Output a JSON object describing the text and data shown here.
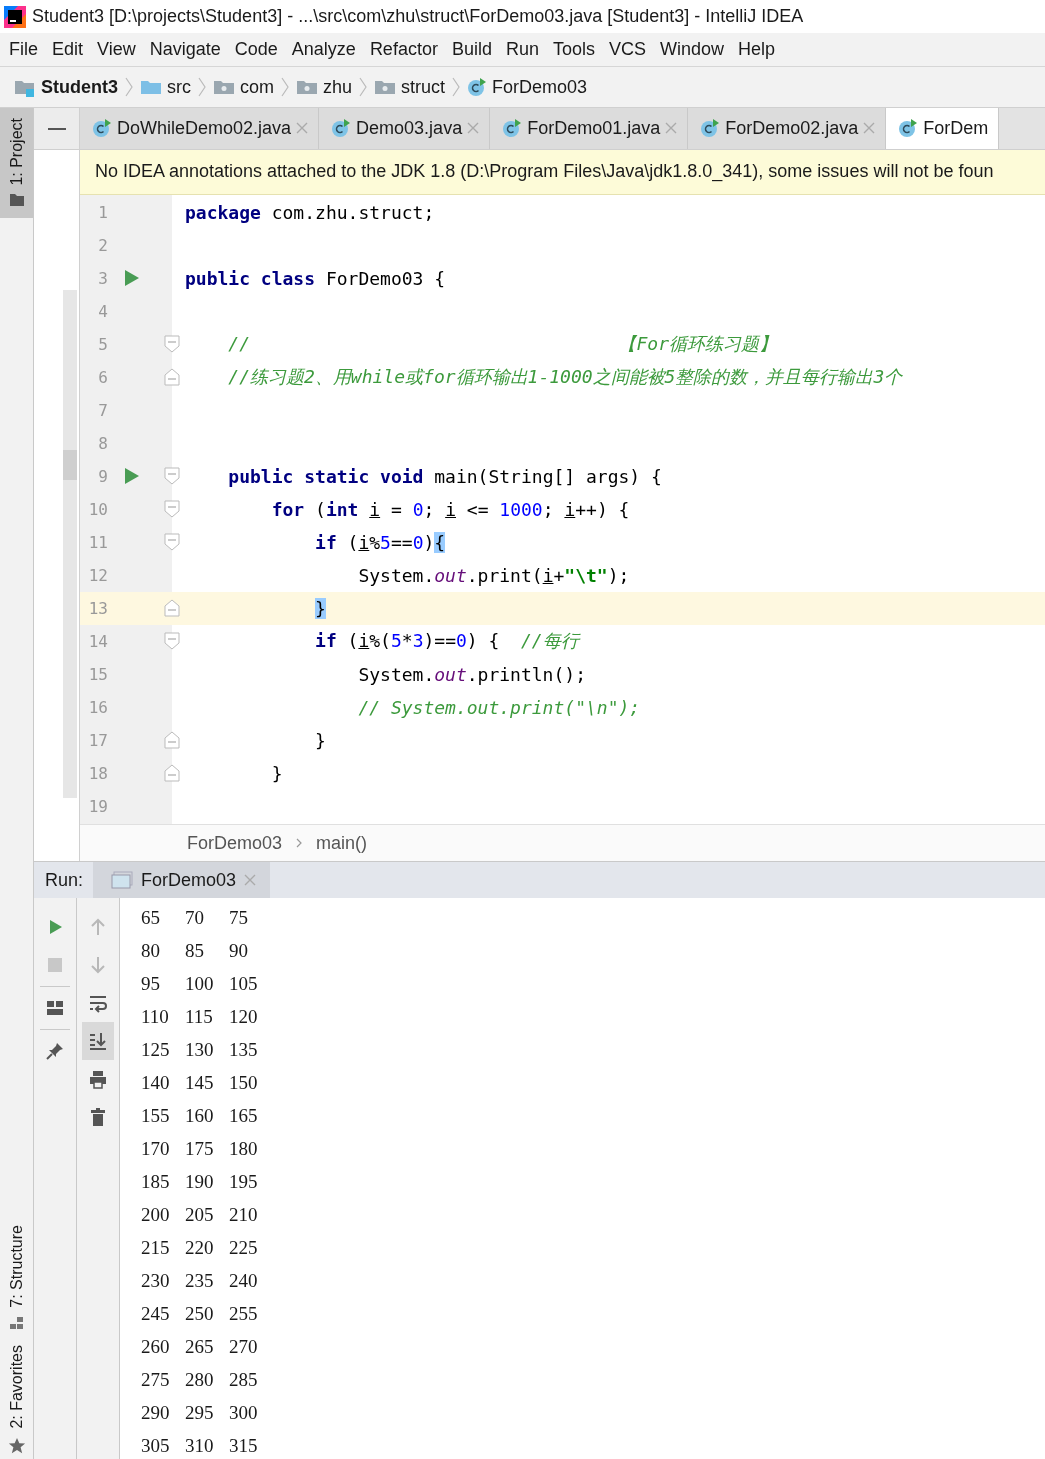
{
  "window": {
    "title": "Student3 [D:\\projects\\Student3] - ...\\src\\com\\zhu\\struct\\ForDemo03.java [Student3] - IntelliJ IDEA"
  },
  "menu": [
    "File",
    "Edit",
    "View",
    "Navigate",
    "Code",
    "Analyze",
    "Refactor",
    "Build",
    "Run",
    "Tools",
    "VCS",
    "Window",
    "Help"
  ],
  "nav_bar": [
    {
      "label": "Student3",
      "kind": "project"
    },
    {
      "label": "src",
      "kind": "source"
    },
    {
      "label": "com",
      "kind": "package"
    },
    {
      "label": "zhu",
      "kind": "package"
    },
    {
      "label": "struct",
      "kind": "package"
    },
    {
      "label": "ForDemo03",
      "kind": "class"
    }
  ],
  "tool_windows": {
    "top": [
      {
        "label": "1: Project",
        "kind": "project",
        "selected": true
      }
    ],
    "bottom": [
      {
        "label": "7: Structure",
        "kind": "structure",
        "selected": false
      },
      {
        "label": "2: Favorites",
        "kind": "favorites",
        "selected": false
      }
    ]
  },
  "tabs": [
    {
      "label": "DoWhileDemo02.java",
      "selected": false
    },
    {
      "label": "Demo03.java",
      "selected": false
    },
    {
      "label": "ForDemo01.java",
      "selected": false
    },
    {
      "label": "ForDemo02.java",
      "selected": false
    },
    {
      "label": "ForDem",
      "selected": true
    }
  ],
  "banner": "No IDEA annotations attached to the JDK 1.8 (D:\\Program Files\\Java\\jdk1.8.0_341), some issues will not be foun",
  "code": {
    "lines": [
      {
        "number": "1",
        "kind": "plain",
        "current": false,
        "run_marker": false,
        "tokens": [
          {
            "kind": "keyword",
            "text": "package"
          },
          {
            "kind": "plain",
            "text": " com.zhu.struct;"
          }
        ]
      },
      {
        "number": "2",
        "kind": "plain",
        "current": false,
        "run_marker": false
      },
      {
        "number": "3",
        "kind": "plain",
        "current": false,
        "run_marker": true,
        "tokens": [
          {
            "kind": "keyword",
            "text": "public class"
          },
          {
            "kind": "plain",
            "text": " ForDemo03 {"
          }
        ]
      },
      {
        "number": "4",
        "kind": "plain",
        "current": false,
        "run_marker": false
      },
      {
        "number": "5",
        "kind": "fold_start",
        "current": false,
        "run_marker": false,
        "tokens": [
          {
            "kind": "comment",
            "text": "    //                                  【For循环练习题】"
          }
        ]
      },
      {
        "number": "6",
        "kind": "fold_end",
        "current": false,
        "run_marker": false,
        "tokens": [
          {
            "kind": "comment",
            "text": "    //练习题2、用while或for循环输出1-1000之间能被5整除的数，并且每行输出3个"
          }
        ]
      },
      {
        "number": "7",
        "kind": "plain",
        "current": false,
        "run_marker": false
      },
      {
        "number": "8",
        "kind": "plain",
        "current": false,
        "run_marker": false
      },
      {
        "number": "9",
        "kind": "fold_start",
        "current": false,
        "run_marker": true,
        "tokens": [
          {
            "kind": "keyword",
            "text": "    public static void"
          },
          {
            "kind": "plain",
            "text": " main(String[] args) {"
          }
        ]
      },
      {
        "number": "10",
        "kind": "fold_start",
        "current": false,
        "run_marker": false,
        "tokens": [
          {
            "kind": "keyword",
            "text": "        for"
          },
          {
            "kind": "plain",
            "text": " ("
          },
          {
            "kind": "keyword",
            "text": "int "
          },
          {
            "kind": "var",
            "text": "i"
          },
          {
            "kind": "plain",
            "text": " = "
          },
          {
            "kind": "number",
            "text": "0"
          },
          {
            "kind": "plain",
            "text": "; "
          },
          {
            "kind": "var",
            "text": "i"
          },
          {
            "kind": "plain",
            "text": " <= "
          },
          {
            "kind": "number",
            "text": "1000"
          },
          {
            "kind": "plain",
            "text": "; "
          },
          {
            "kind": "var",
            "text": "i"
          },
          {
            "kind": "plain",
            "text": "++) {"
          }
        ]
      },
      {
        "number": "11",
        "kind": "fold_start",
        "current": false,
        "run_marker": false,
        "tokens": [
          {
            "kind": "keyword",
            "text": "            if"
          },
          {
            "kind": "plain",
            "text": " ("
          },
          {
            "kind": "var",
            "text": "i"
          },
          {
            "kind": "plain",
            "text": "%"
          },
          {
            "kind": "number",
            "text": "5"
          },
          {
            "kind": "plain",
            "text": "=="
          },
          {
            "kind": "number",
            "text": "0"
          },
          {
            "kind": "plain",
            "text": ")"
          },
          {
            "kind": "brace_match",
            "text": "{"
          }
        ]
      },
      {
        "number": "12",
        "kind": "plain",
        "current": false,
        "run_marker": false,
        "tokens": [
          {
            "kind": "plain",
            "text": "                System."
          },
          {
            "kind": "field",
            "text": "out"
          },
          {
            "kind": "plain",
            "text": ".print("
          },
          {
            "kind": "var",
            "text": "i"
          },
          {
            "kind": "plain",
            "text": "+"
          },
          {
            "kind": "string",
            "text": "\"\\t\""
          },
          {
            "kind": "plain",
            "text": ");"
          }
        ]
      },
      {
        "number": "13",
        "kind": "fold_end",
        "current": true,
        "run_marker": false,
        "tokens": [
          {
            "kind": "brace_match",
            "text": "            }"
          }
        ]
      },
      {
        "number": "14",
        "kind": "fold_start",
        "current": false,
        "run_marker": false,
        "tokens": [
          {
            "kind": "keyword",
            "text": "            if"
          },
          {
            "kind": "plain",
            "text": " ("
          },
          {
            "kind": "var",
            "text": "i"
          },
          {
            "kind": "plain",
            "text": "%("
          },
          {
            "kind": "number",
            "text": "5"
          },
          {
            "kind": "plain",
            "text": "*"
          },
          {
            "kind": "number",
            "text": "3"
          },
          {
            "kind": "plain",
            "text": ")=="
          },
          {
            "kind": "number",
            "text": "0"
          },
          {
            "kind": "plain",
            "text": ") {  "
          },
          {
            "kind": "comment",
            "text": "//每行"
          }
        ]
      },
      {
        "number": "15",
        "kind": "plain",
        "current": false,
        "run_marker": false,
        "tokens": [
          {
            "kind": "plain",
            "text": "                System."
          },
          {
            "kind": "field",
            "text": "out"
          },
          {
            "kind": "plain",
            "text": ".println();"
          }
        ]
      },
      {
        "number": "16",
        "kind": "plain",
        "current": false,
        "run_marker": false,
        "tokens": [
          {
            "kind": "comment",
            "text": "                // System.out.print(\"\\n\");"
          }
        ]
      },
      {
        "number": "17",
        "kind": "fold_end",
        "current": false,
        "run_marker": false,
        "tokens": [
          {
            "kind": "plain",
            "text": "            }"
          }
        ]
      },
      {
        "number": "18",
        "kind": "fold_end",
        "current": false,
        "run_marker": false,
        "tokens": [
          {
            "kind": "plain",
            "text": "        }"
          }
        ]
      },
      {
        "number": "19",
        "kind": "plain",
        "current": false,
        "run_marker": false
      }
    ]
  },
  "breadcrumbs": [
    "ForDemo03",
    "main()"
  ],
  "run_panel": {
    "label": "Run:",
    "tab": "ForDemo03",
    "tools": [
      {
        "kind": "run",
        "on": true
      },
      {
        "kind": "stop",
        "on": false
      },
      {
        "kind": "layout",
        "on": true
      },
      {
        "kind": "pin",
        "on": true
      }
    ],
    "secondary_tools": [
      {
        "kind": "up",
        "on": false,
        "selected": false
      },
      {
        "kind": "down",
        "on": false,
        "selected": false
      },
      {
        "kind": "wrap",
        "on": true,
        "selected": false
      },
      {
        "kind": "scroll_end",
        "on": true,
        "selected": true
      },
      {
        "kind": "print",
        "on": true,
        "selected": false
      },
      {
        "kind": "trash",
        "on": true,
        "selected": false
      }
    ],
    "output": [
      [
        "65",
        "70",
        "75"
      ],
      [
        "80",
        "85",
        "90"
      ],
      [
        "95",
        "100",
        "105"
      ],
      [
        "110",
        "115",
        "120"
      ],
      [
        "125",
        "130",
        "135"
      ],
      [
        "140",
        "145",
        "150"
      ],
      [
        "155",
        "160",
        "165"
      ],
      [
        "170",
        "175",
        "180"
      ],
      [
        "185",
        "190",
        "195"
      ],
      [
        "200",
        "205",
        "210"
      ],
      [
        "215",
        "220",
        "225"
      ],
      [
        "230",
        "235",
        "240"
      ],
      [
        "245",
        "250",
        "255"
      ],
      [
        "260",
        "265",
        "270"
      ],
      [
        "275",
        "280",
        "285"
      ],
      [
        "290",
        "295",
        "300"
      ],
      [
        "305",
        "310",
        "315"
      ]
    ]
  }
}
